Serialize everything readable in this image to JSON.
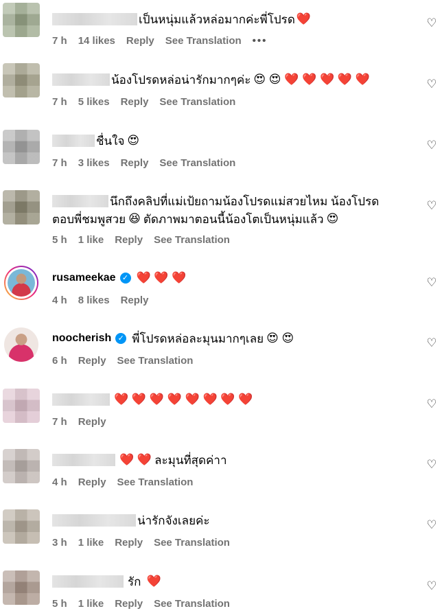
{
  "comments": [
    {
      "id": "c1",
      "blurred": true,
      "avatar_colors": [
        "#b8b8a8",
        "#6f8a5a",
        "#a7b39a"
      ],
      "username": "",
      "text": "เป็นหนุ่มแล้วหล่อมากค่ะพี่โปรด",
      "emojis": "❤️",
      "time": "7 h",
      "likes": "14 likes",
      "reply": "Reply",
      "translation": "See Translation",
      "more": "•••"
    },
    {
      "id": "c2",
      "blurred": true,
      "avatar_colors": [
        "#d7c9c7",
        "#7c8a6d",
        "#c9b49e"
      ],
      "username": "",
      "text": "น้องโปรดหล่อน่ารักมากๆค่ะ",
      "emojis": "😍 😍 ❤️ ❤️ ❤️ ❤️ ❤️",
      "time": "7 h",
      "likes": "5 likes",
      "reply": "Reply",
      "translation": "See Translation"
    },
    {
      "id": "c3",
      "blurred": true,
      "avatar_colors": [
        "#c6c6c6",
        "#8c8c8c",
        "#b0b0b0"
      ],
      "username": "",
      "text": "ชื่นใจ",
      "emojis": "😍",
      "time": "7 h",
      "likes": "3 likes",
      "reply": "Reply",
      "translation": "See Translation"
    },
    {
      "id": "c4",
      "blurred": true,
      "avatar_colors": [
        "#c9cdd4",
        "#6d6a52",
        "#a89a85"
      ],
      "username": "",
      "text": "นึกถึงคลิปที่แม่เป้ยถามน้องโปรดแม่สวยไหม น้องโปรด",
      "text2": "ตอบพี่ชมพูสวย",
      "emoji_mid": "😆",
      "text3": "ตัดภาพมาตอนนี้น้องโตเป็นหนุ่มแล้ว",
      "emojis": "😍",
      "time": "5 h",
      "likes": "1 like",
      "reply": "Reply",
      "translation": "See Translation"
    },
    {
      "id": "c5",
      "blurred": false,
      "username": "rusameekae",
      "verified_mark": "✓",
      "text": "",
      "emojis": "❤️ ❤️ ❤️",
      "time": "4 h",
      "likes": "8 likes",
      "reply": "Reply"
    },
    {
      "id": "c6",
      "blurred": false,
      "username": "noocherish",
      "verified_mark": "✓",
      "text": "พี่โปรดหล่อละมุนมากๆเลย",
      "emojis": "😍 😍",
      "time": "6 h",
      "reply": "Reply",
      "translation": "See Translation"
    },
    {
      "id": "c7",
      "blurred": true,
      "avatar_colors": [
        "#e8c8d8",
        "#d2b0c0",
        "#c8bcc4"
      ],
      "username": "",
      "text": "",
      "emojis": "❤️ ❤️ ❤️ ❤️ ❤️ ❤️ ❤️ ❤️",
      "time": "7 h",
      "reply": "Reply"
    },
    {
      "id": "c8",
      "blurred": true,
      "avatar_colors": [
        "#d0cccc",
        "#a89c98",
        "#c4bcb8"
      ],
      "username": "",
      "text": "ละมุนที่สุดค่าา",
      "emojis_before": "❤️ ❤️",
      "time": "4 h",
      "reply": "Reply",
      "translation": "See Translation"
    },
    {
      "id": "c9",
      "blurred": true,
      "avatar_colors": [
        "#d4ccc4",
        "#8f8878",
        "#c2b8ac"
      ],
      "username": "",
      "text": "น่ารักจังเลยค่ะ",
      "emojis": "",
      "time": "3 h",
      "likes": "1 like",
      "reply": "Reply",
      "translation": "See Translation"
    },
    {
      "id": "c10",
      "blurred": true,
      "avatar_colors": [
        "#c8bab2",
        "#7a6a60",
        "#b8a8a0"
      ],
      "username": "",
      "text": "รัก",
      "emojis": "❤️",
      "time": "5 h",
      "likes": "1 like",
      "reply": "Reply",
      "translation": "See Translation"
    }
  ],
  "like_icon": "heart-outline-icon",
  "like_glyph": "♡"
}
